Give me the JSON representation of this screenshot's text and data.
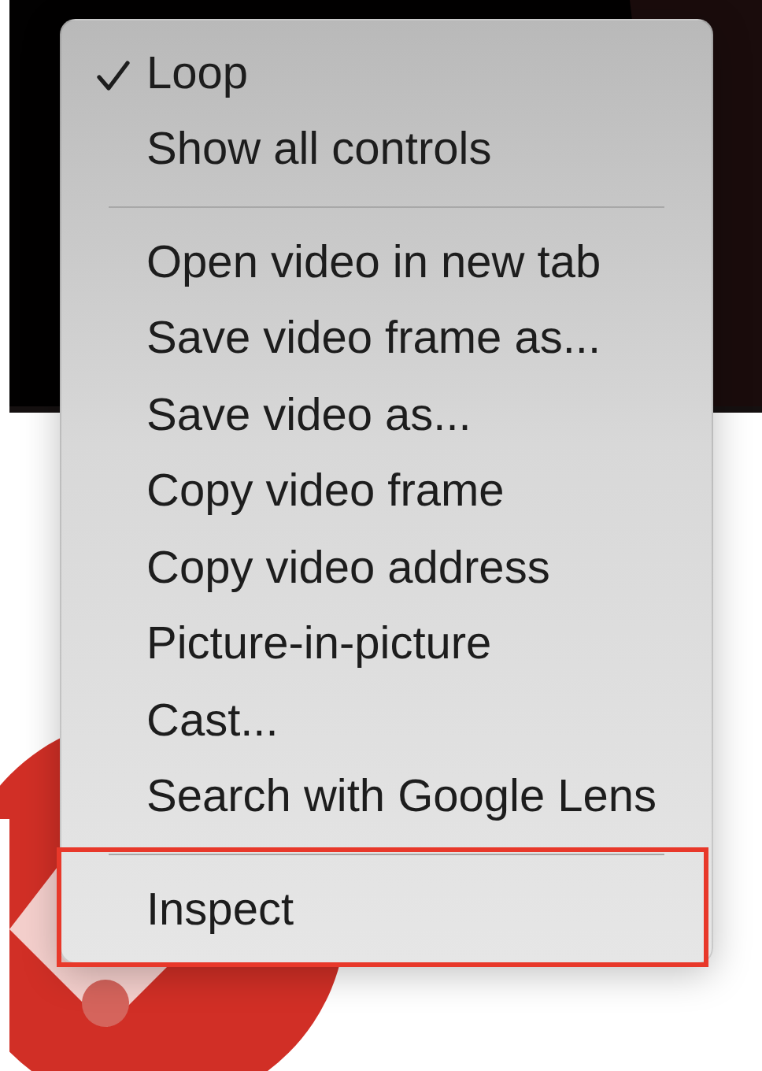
{
  "context_menu": {
    "items": [
      {
        "kind": "item",
        "label": "Loop",
        "checked": true,
        "highlighted": false
      },
      {
        "kind": "item",
        "label": "Show all controls",
        "checked": false,
        "highlighted": false
      },
      {
        "kind": "separator"
      },
      {
        "kind": "item",
        "label": "Open video in new tab",
        "checked": false,
        "highlighted": false
      },
      {
        "kind": "item",
        "label": "Save video frame as...",
        "checked": false,
        "highlighted": false
      },
      {
        "kind": "item",
        "label": "Save video as...",
        "checked": false,
        "highlighted": false
      },
      {
        "kind": "item",
        "label": "Copy video frame",
        "checked": false,
        "highlighted": false
      },
      {
        "kind": "item",
        "label": "Copy video address",
        "checked": false,
        "highlighted": false
      },
      {
        "kind": "item",
        "label": "Picture-in-picture",
        "checked": false,
        "highlighted": false
      },
      {
        "kind": "item",
        "label": "Cast...",
        "checked": false,
        "highlighted": false
      },
      {
        "kind": "item",
        "label": "Search with Google Lens",
        "checked": false,
        "highlighted": false
      },
      {
        "kind": "separator"
      },
      {
        "kind": "item",
        "label": "Inspect",
        "checked": false,
        "highlighted": true
      }
    ]
  }
}
